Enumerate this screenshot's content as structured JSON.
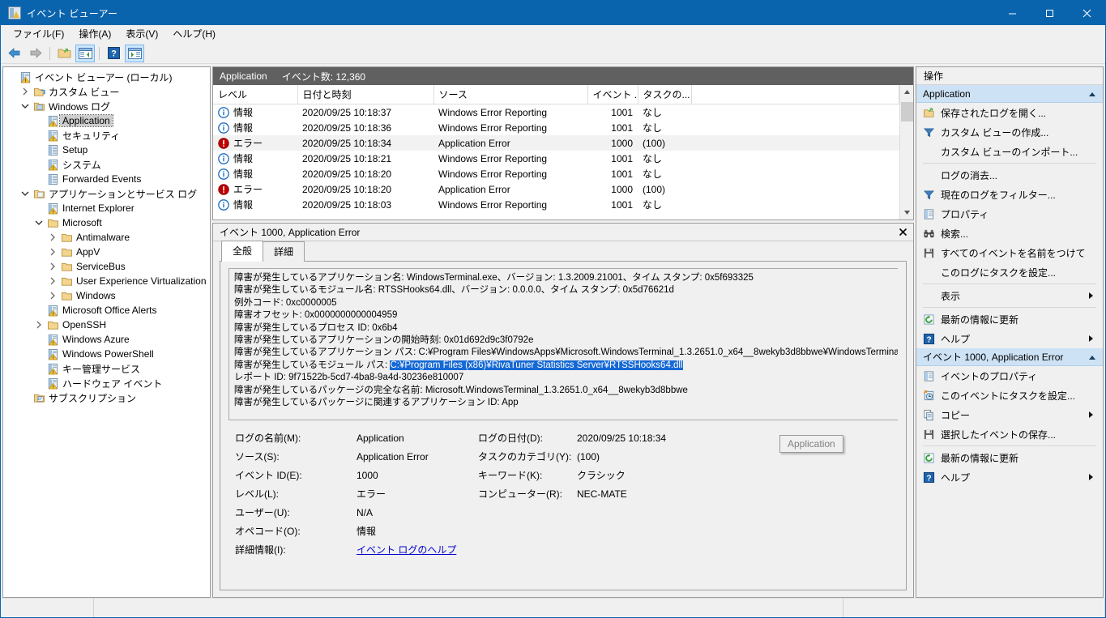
{
  "window": {
    "title": "イベント ビューアー",
    "icon": "event-viewer-icon",
    "minimize": "—",
    "maximize": "□",
    "close": "✕"
  },
  "menubar": {
    "items": [
      {
        "label": "ファイル(F)",
        "accel": "F"
      },
      {
        "label": "操作(A)",
        "accel": "A"
      },
      {
        "label": "表示(V)",
        "accel": "V"
      },
      {
        "label": "ヘルプ(H)",
        "accel": "H"
      }
    ]
  },
  "toolbar": {
    "buttons": [
      {
        "name": "back-icon",
        "checked": false
      },
      {
        "name": "forward-icon",
        "checked": false
      },
      {
        "name": "show-open-icon",
        "checked": false
      },
      {
        "name": "show-console-tree-icon",
        "checked": true
      },
      {
        "name": "help-icon",
        "checked": false
      },
      {
        "name": "show-action-pane-icon",
        "checked": true
      }
    ]
  },
  "tree": {
    "nodes": [
      {
        "label": "イベント ビューアー (ローカル)",
        "indent": 0,
        "twist": "none",
        "icon": "event-viewer-icon",
        "selected": false
      },
      {
        "label": "カスタム ビュー",
        "indent": 1,
        "twist": "collapsed",
        "icon": "folder-view-icon",
        "selected": false
      },
      {
        "label": "Windows ログ",
        "indent": 1,
        "twist": "expanded",
        "icon": "folder-logs-icon",
        "selected": false
      },
      {
        "label": "Application",
        "indent": 2,
        "twist": "none",
        "icon": "log-icon",
        "selected": true
      },
      {
        "label": "セキュリティ",
        "indent": 2,
        "twist": "none",
        "icon": "log-icon",
        "selected": false
      },
      {
        "label": "Setup",
        "indent": 2,
        "twist": "none",
        "icon": "log-plain-icon",
        "selected": false
      },
      {
        "label": "システム",
        "indent": 2,
        "twist": "none",
        "icon": "log-icon",
        "selected": false
      },
      {
        "label": "Forwarded Events",
        "indent": 2,
        "twist": "none",
        "icon": "log-plain-icon",
        "selected": false
      },
      {
        "label": "アプリケーションとサービス ログ",
        "indent": 1,
        "twist": "expanded",
        "icon": "folder-apps-icon",
        "selected": false
      },
      {
        "label": "Internet Explorer",
        "indent": 2,
        "twist": "none",
        "icon": "log-icon",
        "selected": false
      },
      {
        "label": "Microsoft",
        "indent": 2,
        "twist": "expanded",
        "icon": "folder-icon",
        "selected": false
      },
      {
        "label": "Antimalware",
        "indent": 3,
        "twist": "collapsed",
        "icon": "folder-icon",
        "selected": false
      },
      {
        "label": "AppV",
        "indent": 3,
        "twist": "collapsed",
        "icon": "folder-icon",
        "selected": false
      },
      {
        "label": "ServiceBus",
        "indent": 3,
        "twist": "collapsed",
        "icon": "folder-icon",
        "selected": false
      },
      {
        "label": "User Experience Virtualization",
        "indent": 3,
        "twist": "collapsed",
        "icon": "folder-icon",
        "selected": false
      },
      {
        "label": "Windows",
        "indent": 3,
        "twist": "collapsed",
        "icon": "folder-icon",
        "selected": false
      },
      {
        "label": "Microsoft Office Alerts",
        "indent": 2,
        "twist": "none",
        "icon": "log-icon",
        "selected": false
      },
      {
        "label": "OpenSSH",
        "indent": 2,
        "twist": "collapsed",
        "icon": "folder-icon",
        "selected": false
      },
      {
        "label": "Windows Azure",
        "indent": 2,
        "twist": "none",
        "icon": "log-icon",
        "selected": false
      },
      {
        "label": "Windows PowerShell",
        "indent": 2,
        "twist": "none",
        "icon": "log-icon",
        "selected": false
      },
      {
        "label": "キー管理サービス",
        "indent": 2,
        "twist": "none",
        "icon": "log-icon",
        "selected": false
      },
      {
        "label": "ハードウェア イベント",
        "indent": 2,
        "twist": "none",
        "icon": "log-icon",
        "selected": false
      },
      {
        "label": "サブスクリプション",
        "indent": 1,
        "twist": "none",
        "icon": "subscription-icon",
        "selected": false
      }
    ]
  },
  "event_list": {
    "header_log_name": "Application",
    "header_count": "イベント数: 12,360",
    "columns": [
      "レベル",
      "日付と時刻",
      "ソース",
      "イベント ...",
      "タスクの..."
    ],
    "rows": [
      {
        "level": "情報",
        "level_icon": "information-icon",
        "datetime": "2020/09/25 10:18:37",
        "source": "Windows Error Reporting",
        "event_id": "1001",
        "task": "なし",
        "selected": false
      },
      {
        "level": "情報",
        "level_icon": "information-icon",
        "datetime": "2020/09/25 10:18:36",
        "source": "Windows Error Reporting",
        "event_id": "1001",
        "task": "なし",
        "selected": false
      },
      {
        "level": "エラー",
        "level_icon": "error-icon",
        "datetime": "2020/09/25 10:18:34",
        "source": "Application Error",
        "event_id": "1000",
        "task": "(100)",
        "selected": true
      },
      {
        "level": "情報",
        "level_icon": "information-icon",
        "datetime": "2020/09/25 10:18:21",
        "source": "Windows Error Reporting",
        "event_id": "1001",
        "task": "なし",
        "selected": false
      },
      {
        "level": "情報",
        "level_icon": "information-icon",
        "datetime": "2020/09/25 10:18:20",
        "source": "Windows Error Reporting",
        "event_id": "1001",
        "task": "なし",
        "selected": false
      },
      {
        "level": "エラー",
        "level_icon": "error-icon",
        "datetime": "2020/09/25 10:18:20",
        "source": "Application Error",
        "event_id": "1000",
        "task": "(100)",
        "selected": false
      },
      {
        "level": "情報",
        "level_icon": "information-icon",
        "datetime": "2020/09/25 10:18:03",
        "source": "Windows Error Reporting",
        "event_id": "1001",
        "task": "なし",
        "selected": false
      }
    ]
  },
  "detail": {
    "title": "イベント 1000, Application Error",
    "close_icon": "close-icon",
    "tabs": [
      {
        "label": "全般",
        "active": true
      },
      {
        "label": "詳細",
        "active": false
      }
    ],
    "description_lines": [
      {
        "text": "障害が発生しているアプリケーション名: WindowsTerminal.exe、バージョン: 1.3.2009.21001、タイム スタンプ: 0x5f693325"
      },
      {
        "text": "障害が発生しているモジュール名: RTSSHooks64.dll、バージョン: 0.0.0.0、タイム スタンプ: 0x5d76621d"
      },
      {
        "text": "例外コード: 0xc0000005"
      },
      {
        "text": "障害オフセット: 0x0000000000004959"
      },
      {
        "text": "障害が発生しているプロセス ID: 0x6b4"
      },
      {
        "text": "障害が発生しているアプリケーションの開始時刻: 0x01d692d9c3f0792e"
      },
      {
        "text": "障害が発生しているアプリケーション パス: C:¥Program Files¥WindowsApps¥Microsoft.WindowsTerminal_1.3.2651.0_x64__8wekyb3d8bbwe¥WindowsTerminal.exe"
      },
      {
        "prefix": "障害が発生しているモジュール パス: ",
        "highlight": "C:¥Program Files (x86)¥RivaTuner Statistics Server¥RTSSHooks64.dll"
      },
      {
        "text": "レポート ID: 9f71522b-5cd7-4ba8-9a4d-30236e810007"
      },
      {
        "text": "障害が発生しているパッケージの完全な名前: Microsoft.WindowsTerminal_1.3.2651.0_x64__8wekyb3d8bbwe"
      },
      {
        "text": "障害が発生しているパッケージに関連するアプリケーション ID: App"
      }
    ],
    "fields_left": [
      {
        "label": "ログの名前(M):",
        "accel": "M",
        "value": "Application"
      },
      {
        "label": "ソース(S):",
        "accel": "S",
        "value": "Application Error"
      },
      {
        "label": "イベント ID(E):",
        "accel": "E",
        "value": "1000"
      },
      {
        "label": "レベル(L):",
        "accel": "L",
        "value": "エラー"
      },
      {
        "label": "ユーザー(U):",
        "accel": "U",
        "value": "N/A"
      },
      {
        "label": "オペコード(O):",
        "accel": "O",
        "value": "情報"
      },
      {
        "label": "詳細情報(I):",
        "accel": "I",
        "value": "イベント ログのヘルプ",
        "is_link": true
      }
    ],
    "fields_right": [
      {
        "label": "ログの日付(D):",
        "accel": "D",
        "value": "2020/09/25 10:18:34"
      },
      {
        "label": "タスクのカテゴリ(Y):",
        "accel": "Y",
        "value": "(100)"
      },
      {
        "label": "キーワード(K):",
        "accel": "K",
        "value": "クラシック"
      },
      {
        "label": "コンピューター(R):",
        "accel": "R",
        "value": "NEC-MATE"
      }
    ],
    "floating_button": "Application"
  },
  "actions": {
    "title": "操作",
    "groups": [
      {
        "header": "Application",
        "collapse_icon": "chevron-up-icon",
        "items": [
          {
            "label": "保存されたログを開く...",
            "icon": "open-folder-icon",
            "submenu": false,
            "sep_before": false
          },
          {
            "label": "カスタム ビューの作成...",
            "icon": "filter-icon",
            "submenu": false,
            "sep_before": false
          },
          {
            "label": "カスタム ビューのインポート...",
            "icon": "none",
            "submenu": false,
            "sep_before": false
          },
          {
            "label": "ログの消去...",
            "icon": "none",
            "submenu": false,
            "sep_before": true
          },
          {
            "label": "現在のログをフィルター...",
            "icon": "filter-icon",
            "submenu": false,
            "sep_before": false
          },
          {
            "label": "プロパティ",
            "icon": "properties-icon",
            "submenu": false,
            "sep_before": false
          },
          {
            "label": "検索...",
            "icon": "binoculars-icon",
            "submenu": false,
            "sep_before": false
          },
          {
            "label": "すべてのイベントを名前をつけて保...",
            "icon": "save-icon",
            "submenu": false,
            "sep_before": false
          },
          {
            "label": "このログにタスクを設定...",
            "icon": "none",
            "submenu": false,
            "sep_before": false
          },
          {
            "label": "表示",
            "icon": "none",
            "submenu": true,
            "sep_before": true
          },
          {
            "label": "最新の情報に更新",
            "icon": "refresh-icon",
            "submenu": false,
            "sep_before": true
          },
          {
            "label": "ヘルプ",
            "icon": "help-icon",
            "submenu": true,
            "sep_before": false
          }
        ]
      },
      {
        "header": "イベント 1000, Application Error",
        "collapse_icon": "chevron-up-icon",
        "items": [
          {
            "label": "イベントのプロパティ",
            "icon": "properties-icon",
            "submenu": false,
            "sep_before": false
          },
          {
            "label": "このイベントにタスクを設定...",
            "icon": "task-clock-icon",
            "submenu": false,
            "sep_before": false
          },
          {
            "label": "コピー",
            "icon": "copy-icon",
            "submenu": true,
            "sep_before": false
          },
          {
            "label": "選択したイベントの保存...",
            "icon": "save-icon",
            "submenu": false,
            "sep_before": false
          },
          {
            "label": "最新の情報に更新",
            "icon": "refresh-icon",
            "submenu": false,
            "sep_before": true
          },
          {
            "label": "ヘルプ",
            "icon": "help-icon",
            "submenu": true,
            "sep_before": false
          }
        ]
      }
    ]
  },
  "statusbar": {
    "cells": [
      "",
      "",
      ""
    ]
  },
  "colors": {
    "titlebar": "#0a64ad",
    "accent_selection": "#1669d4",
    "group_header": "#cde2f5",
    "list_header": "#606060",
    "error_red": "#c00000",
    "info_blue": "#1b6ec2",
    "link": "#0000cc"
  }
}
